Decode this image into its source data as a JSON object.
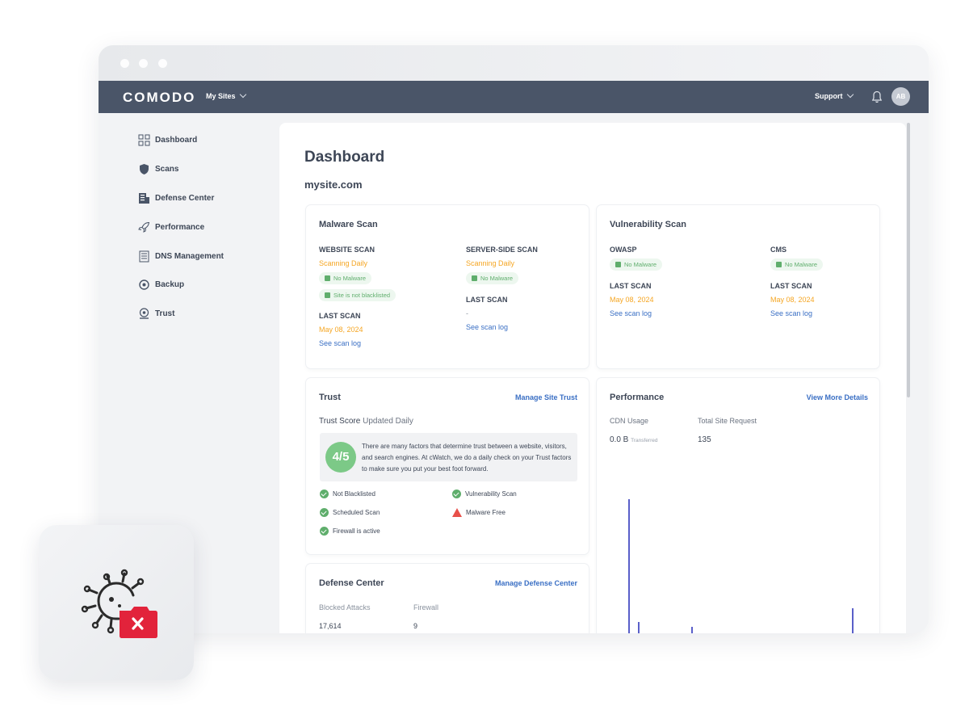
{
  "navbar": {
    "logo": "COMODO",
    "sites_label": "My Sites",
    "support_label": "Support",
    "avatar_initials": "AB"
  },
  "sidebar": {
    "items": [
      {
        "label": "Dashboard",
        "icon": "dashboard-icon"
      },
      {
        "label": "Scans",
        "icon": "shield-icon"
      },
      {
        "label": "Defense Center",
        "icon": "server-icon"
      },
      {
        "label": "Performance",
        "icon": "rocket-icon"
      },
      {
        "label": "DNS Management",
        "icon": "dns-icon"
      },
      {
        "label": "Backup",
        "icon": "backup-icon"
      },
      {
        "label": "Trust",
        "icon": "trust-icon"
      }
    ]
  },
  "main": {
    "title": "Dashboard",
    "site": "mysite.com"
  },
  "malware": {
    "title": "Malware Scan",
    "website": {
      "label": "WEBSITE SCAN",
      "freq": "Scanning Daily",
      "pill1": "No Malware",
      "pill2": "Site is not blacklisted",
      "last_label": "LAST SCAN",
      "last_date": "May 08, 2024",
      "log": "See scan log"
    },
    "server": {
      "label": "SERVER-SIDE SCAN",
      "freq": "Scanning Daily",
      "pill1": "No Malware",
      "last_label": "LAST SCAN",
      "last_date": "-",
      "log": "See scan log"
    }
  },
  "vuln": {
    "title": "Vulnerability Scan",
    "owasp": {
      "label": "OWASP",
      "pill": "No Malware",
      "last_label": "LAST SCAN",
      "last_date": "May 08, 2024",
      "log": "See scan log"
    },
    "cms": {
      "label": "CMS",
      "pill": "No Malware",
      "last_label": "LAST SCAN",
      "last_date": "May 08, 2024",
      "log": "See scan log"
    }
  },
  "trust": {
    "title": "Trust",
    "link": "Manage Site Trust",
    "score_label": "Trust Score",
    "score_sub": "Updated Daily",
    "score": "4/5",
    "text": "There are many factors that determine trust between a website, visitors, and search engines. At cWatch, we do a daily check on your Trust factors to make sure you put your best foot forward.",
    "checks": [
      "Not Blacklisted",
      "Vulnerability Scan",
      "Scheduled Scan",
      "Malware Free",
      "Firewall is active"
    ]
  },
  "performance": {
    "title": "Performance",
    "link": "View More Details",
    "cdn_label": "CDN Usage",
    "cdn_value": "0.0 B",
    "cdn_unit": "Transferred",
    "req_label": "Total Site Request",
    "req_value": "135",
    "accent": "#5a5fc9"
  },
  "defense": {
    "title": "Defense Center",
    "link": "Manage Defense Center",
    "blocked_label": "Blocked Attacks",
    "blocked_value": "17,614",
    "firewall_label": "Firewall",
    "firewall_value": "9"
  }
}
